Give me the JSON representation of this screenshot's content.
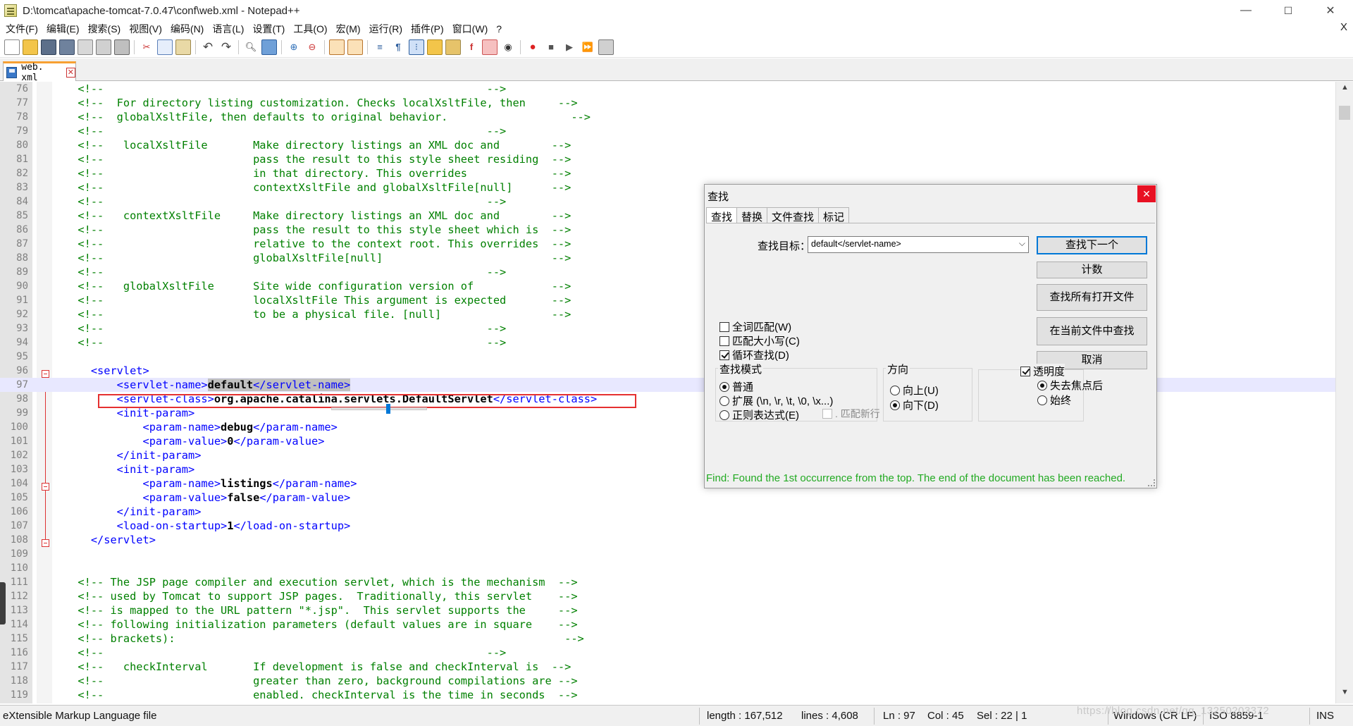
{
  "window": {
    "title": "D:\\tomcat\\apache-tomcat-7.0.47\\conf\\web.xml - Notepad++",
    "min": "—",
    "max": "☐",
    "close": "✕"
  },
  "menu": {
    "items": [
      "文件(F)",
      "编辑(E)",
      "搜索(S)",
      "视图(V)",
      "编码(N)",
      "语言(L)",
      "设置(T)",
      "工具(O)",
      "宏(M)",
      "运行(R)",
      "插件(P)",
      "窗口(W)",
      "?"
    ],
    "close": "X"
  },
  "tab": {
    "label": "web. xml",
    "close": "✕"
  },
  "editor": {
    "lines": [
      {
        "n": "76",
        "t": "  <!--                                                           -->",
        "k": "comment"
      },
      {
        "n": "77",
        "t": "  <!--  For directory listing customization. Checks localXsltFile, then     -->",
        "k": "comment"
      },
      {
        "n": "78",
        "t": "  <!--  globalXsltFile, then defaults to original behavior.                   -->",
        "k": "comment"
      },
      {
        "n": "79",
        "t": "  <!--                                                           -->",
        "k": "comment"
      },
      {
        "n": "80",
        "t": "  <!--   localXsltFile       Make directory listings an XML doc and        -->",
        "k": "comment"
      },
      {
        "n": "81",
        "t": "  <!--                       pass the result to this style sheet residing  -->",
        "k": "comment"
      },
      {
        "n": "82",
        "t": "  <!--                       in that directory. This overrides             -->",
        "k": "comment"
      },
      {
        "n": "83",
        "t": "  <!--                       contextXsltFile and globalXsltFile[null]      -->",
        "k": "comment"
      },
      {
        "n": "84",
        "t": "  <!--                                                           -->",
        "k": "comment"
      },
      {
        "n": "85",
        "t": "  <!--   contextXsltFile     Make directory listings an XML doc and        -->",
        "k": "comment"
      },
      {
        "n": "86",
        "t": "  <!--                       pass the result to this style sheet which is  -->",
        "k": "comment"
      },
      {
        "n": "87",
        "t": "  <!--                       relative to the context root. This overrides  -->",
        "k": "comment"
      },
      {
        "n": "88",
        "t": "  <!--                       globalXsltFile[null]                          -->",
        "k": "comment"
      },
      {
        "n": "89",
        "t": "  <!--                                                           -->",
        "k": "comment"
      },
      {
        "n": "90",
        "t": "  <!--   globalXsltFile      Site wide configuration version of            -->",
        "k": "comment"
      },
      {
        "n": "91",
        "t": "  <!--                       localXsltFile This argument is expected       -->",
        "k": "comment"
      },
      {
        "n": "92",
        "t": "  <!--                       to be a physical file. [null]                 -->",
        "k": "comment"
      },
      {
        "n": "93",
        "t": "  <!--                                                           -->",
        "k": "comment"
      },
      {
        "n": "94",
        "t": "  <!--                                                           -->",
        "k": "comment"
      },
      {
        "n": "95",
        "t": "",
        "k": "plain"
      },
      {
        "n": "96",
        "t": "    <servlet>",
        "k": "tag"
      },
      {
        "n": "97",
        "pre": "        <servlet-name>",
        "mid": "default",
        "post": "</servlet-name>",
        "k": "mixed",
        "highlight": true
      },
      {
        "n": "98",
        "pre": "        <servlet-class>",
        "mid": "org.apache.catalina.servlets.DefaultServlet",
        "post": "</servlet-class>",
        "k": "mixed"
      },
      {
        "n": "99",
        "t": "        <init-param>",
        "k": "tag"
      },
      {
        "n": "100",
        "pre": "            <param-name>",
        "mid": "debug",
        "post": "</param-name>",
        "k": "mixed"
      },
      {
        "n": "101",
        "pre": "            <param-value>",
        "mid": "0",
        "post": "</param-value>",
        "k": "mixed"
      },
      {
        "n": "102",
        "t": "        </init-param>",
        "k": "tag"
      },
      {
        "n": "103",
        "t": "        <init-param>",
        "k": "tag"
      },
      {
        "n": "104",
        "pre": "            <param-name>",
        "mid": "listings",
        "post": "</param-name>",
        "k": "mixed"
      },
      {
        "n": "105",
        "pre": "            <param-value>",
        "mid": "false",
        "post": "</param-value>",
        "k": "mixed"
      },
      {
        "n": "106",
        "t": "        </init-param>",
        "k": "tag"
      },
      {
        "n": "107",
        "pre": "        <load-on-startup>",
        "mid": "1",
        "post": "</load-on-startup>",
        "k": "mixed"
      },
      {
        "n": "108",
        "t": "    </servlet>",
        "k": "tag"
      },
      {
        "n": "109",
        "t": "",
        "k": "plain"
      },
      {
        "n": "110",
        "t": "",
        "k": "plain"
      },
      {
        "n": "111",
        "t": "  <!-- The JSP page compiler and execution servlet, which is the mechanism  -->",
        "k": "comment"
      },
      {
        "n": "112",
        "t": "  <!-- used by Tomcat to support JSP pages.  Traditionally, this servlet    -->",
        "k": "comment"
      },
      {
        "n": "113",
        "t": "  <!-- is mapped to the URL pattern \"*.jsp\".  This servlet supports the     -->",
        "k": "comment"
      },
      {
        "n": "114",
        "t": "  <!-- following initialization parameters (default values are in square    -->",
        "k": "comment"
      },
      {
        "n": "115",
        "t": "  <!-- brackets):                                                            -->",
        "k": "comment"
      },
      {
        "n": "116",
        "t": "  <!--                                                           -->",
        "k": "comment"
      },
      {
        "n": "117",
        "t": "  <!--   checkInterval       If development is false and checkInterval is  -->",
        "k": "comment"
      },
      {
        "n": "118",
        "t": "  <!--                       greater than zero, background compilations are -->",
        "k": "comment"
      },
      {
        "n": "119",
        "t": "  <!--                       enabled. checkInterval is the time in seconds  -->",
        "k": "comment"
      }
    ]
  },
  "find_dialog": {
    "title": "查找",
    "close": "✕",
    "tabs": [
      "查找",
      "替换",
      "文件查找",
      "标记"
    ],
    "find_label": "查找目标：",
    "find_value": "default</servlet-name>",
    "buttons": {
      "find_next": "查找下一个",
      "count": "计数",
      "find_all_open": "查找所有打开文件",
      "find_in_current": "在当前文件中查找",
      "cancel": "取消"
    },
    "options": {
      "whole_word": "全词匹配(W)",
      "match_case": "匹配大小写(C)",
      "wrap_around": "循环查找(D)"
    },
    "search_mode": {
      "title": "查找模式",
      "normal": "普通",
      "extended": "扩展 (\\n, \\r, \\t, \\0, \\x...)",
      "regex": "正则表达式(E)",
      "dot_newline": ". 匹配新行"
    },
    "direction": {
      "title": "方向",
      "up": "向上(U)",
      "down": "向下(D)"
    },
    "transparency": {
      "title": "透明度",
      "on_lose_focus": "失去焦点后",
      "always": "始终",
      "level": 0.6
    },
    "status": "Find: Found the 1st occurrence from the top. The end of the document has been reached."
  },
  "statusbar": {
    "file_type": "eXtensible Markup Language file",
    "length": "length : 167,512",
    "lines": "lines : 4,608",
    "ln": "Ln : 97",
    "col": "Col : 45",
    "sel": "Sel : 22 | 1",
    "eol": "Windows (CR LF)",
    "encoding": "ISO 8859-1",
    "mode": "INS",
    "watermark": "https://blog.csdn.net/qq_13250203372"
  },
  "colors": {
    "comment": "#008000",
    "tag": "#0000ff",
    "tab_accent": "#f7a032",
    "current_line": "#e8e8ff",
    "found_status": "#22aa22",
    "red_annotation": "#e53030"
  }
}
